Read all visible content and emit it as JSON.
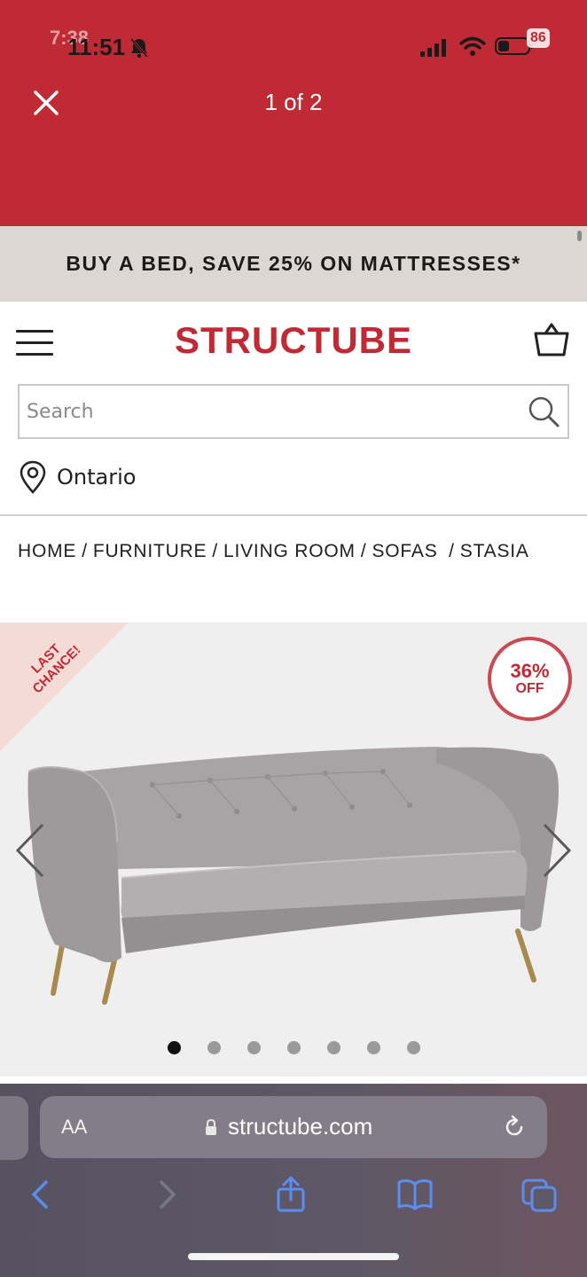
{
  "status_bar": {
    "time": "11:51",
    "time_overlay": "7:38",
    "battery": "86"
  },
  "viewer": {
    "counter": "1 of 2"
  },
  "promo": {
    "text": "BUY A BED, SAVE 25% ON MATTRESSES*"
  },
  "header": {
    "logo": "STRUCTUBE",
    "search_placeholder": "Search",
    "location": "Ontario"
  },
  "breadcrumb": [
    "HOME",
    "FURNITURE",
    "LIVING ROOM",
    "SOFAS",
    "STASIA"
  ],
  "product": {
    "badge_line1": "LAST",
    "badge_line2": "CHANCE!",
    "discount_pct": "36%",
    "discount_label": "OFF",
    "image_count": 7,
    "active_image": 1
  },
  "browser": {
    "aa_label": "AA",
    "url": "structube.com"
  },
  "colors": {
    "brand_red": "#bf2a35",
    "promo_bg": "#dcd7d2",
    "gallery_bg": "#efefef",
    "browser_accent": "#5b8def"
  },
  "icons": {
    "close": "close-icon",
    "menu": "hamburger-icon",
    "cart": "shopping-basket-icon",
    "search": "search-icon",
    "location": "map-pin-icon",
    "lock": "lock-icon",
    "reload": "reload-icon",
    "back": "chevron-left-icon",
    "forward": "chevron-right-icon",
    "share": "share-icon",
    "bookmarks": "book-icon",
    "tabs": "tabs-icon"
  }
}
